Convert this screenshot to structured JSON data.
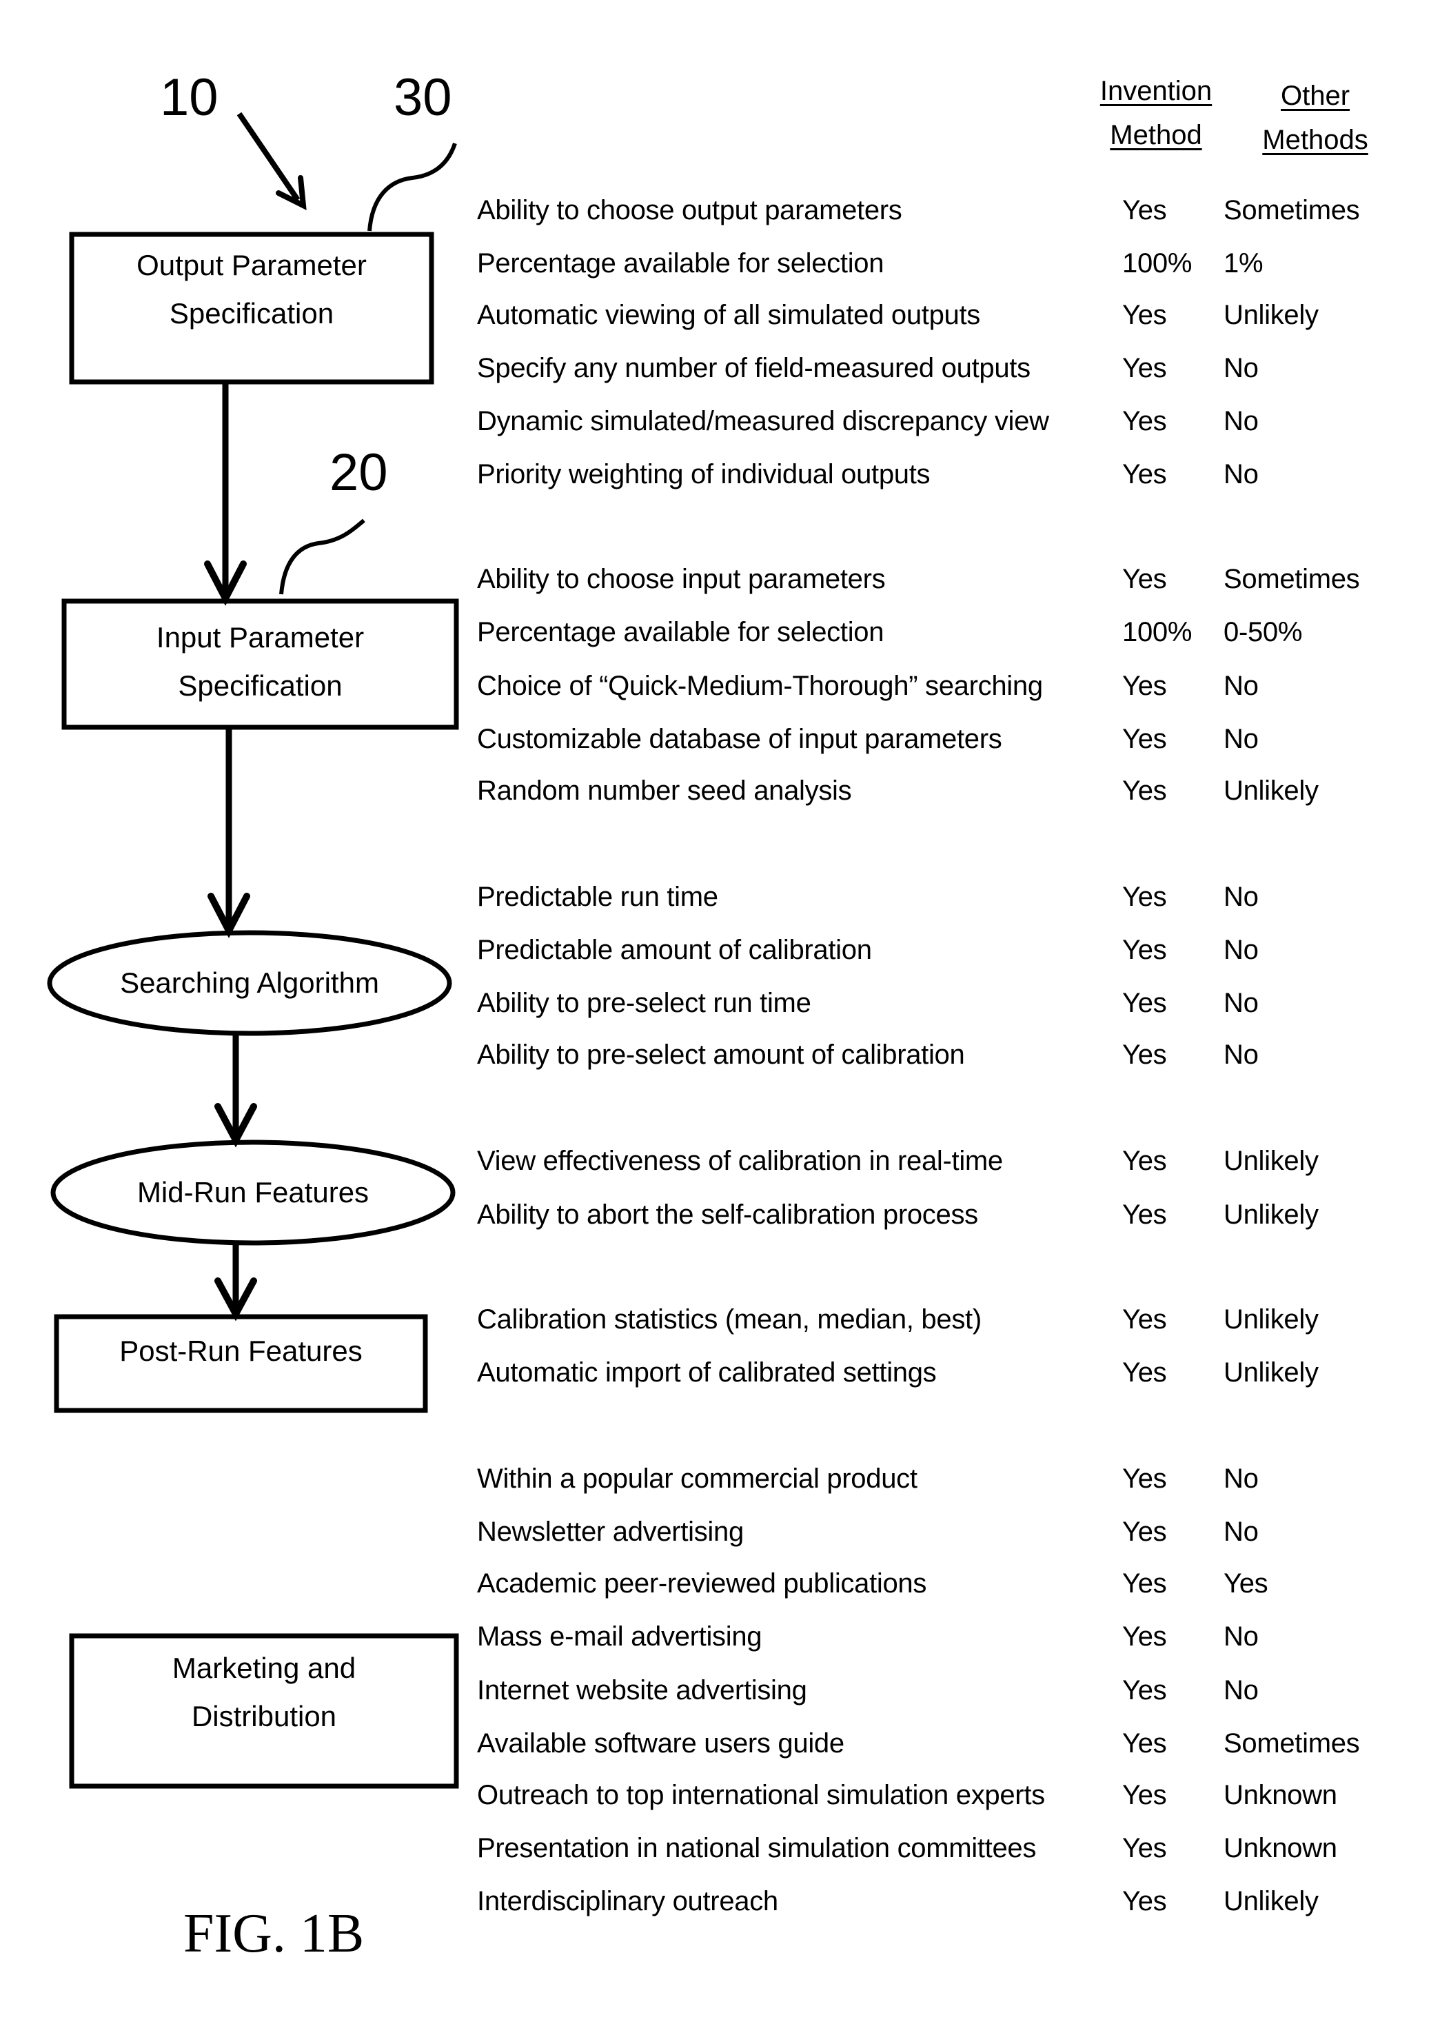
{
  "figure_label": "FIG. 1B",
  "reference_numerals": {
    "overall": "10",
    "input_section": "20",
    "output_section": "30"
  },
  "column_headers": {
    "invention": [
      "Invention",
      "Method"
    ],
    "other": [
      "Other",
      "Methods"
    ]
  },
  "flow_nodes": [
    {
      "id": "output",
      "shape": "rectangle",
      "lines": [
        "Output Parameter",
        "Specification"
      ]
    },
    {
      "id": "input",
      "shape": "rectangle",
      "lines": [
        "Input Parameter",
        "Specification"
      ]
    },
    {
      "id": "search",
      "shape": "ellipse",
      "lines": [
        "Searching Algorithm"
      ]
    },
    {
      "id": "midrun",
      "shape": "ellipse",
      "lines": [
        "Mid-Run Features"
      ]
    },
    {
      "id": "postrun",
      "shape": "rectangle",
      "lines": [
        "Post-Run Features"
      ]
    },
    {
      "id": "marketing",
      "shape": "rectangle",
      "lines": [
        "Marketing and",
        "Distribution"
      ]
    }
  ],
  "feature_groups": [
    {
      "node": "output",
      "rows": [
        {
          "feature": "Ability to choose output parameters",
          "invention": "Yes",
          "other": "Sometimes"
        },
        {
          "feature": "Percentage available for selection",
          "invention": "100%",
          "other": "1%"
        },
        {
          "feature": "Automatic viewing of all simulated outputs",
          "invention": "Yes",
          "other": "Unlikely"
        },
        {
          "feature": "Specify any number of field-measured outputs",
          "invention": "Yes",
          "other": "No"
        },
        {
          "feature": "Dynamic simulated/measured discrepancy view",
          "invention": "Yes",
          "other": "No"
        },
        {
          "feature": "Priority weighting of individual outputs",
          "invention": "Yes",
          "other": "No"
        }
      ]
    },
    {
      "node": "input",
      "rows": [
        {
          "feature": "Ability to choose input parameters",
          "invention": "Yes",
          "other": "Sometimes"
        },
        {
          "feature": "Percentage available for selection",
          "invention": "100%",
          "other": "0-50%"
        },
        {
          "feature": "Choice of “Quick-Medium-Thorough” searching",
          "invention": "Yes",
          "other": "No"
        },
        {
          "feature": "Customizable database of input parameters",
          "invention": "Yes",
          "other": "No"
        },
        {
          "feature": "Random number seed analysis",
          "invention": "Yes",
          "other": "Unlikely"
        }
      ]
    },
    {
      "node": "search",
      "rows": [
        {
          "feature": "Predictable run time",
          "invention": "Yes",
          "other": "No"
        },
        {
          "feature": "Predictable amount of calibration",
          "invention": "Yes",
          "other": "No"
        },
        {
          "feature": "Ability to pre-select run time",
          "invention": "Yes",
          "other": "No"
        },
        {
          "feature": "Ability to pre-select amount of calibration",
          "invention": "Yes",
          "other": "No"
        }
      ]
    },
    {
      "node": "midrun",
      "rows": [
        {
          "feature": "View effectiveness of calibration in real-time",
          "invention": "Yes",
          "other": "Unlikely"
        },
        {
          "feature": "Ability to abort the self-calibration process",
          "invention": "Yes",
          "other": "Unlikely"
        }
      ]
    },
    {
      "node": "postrun",
      "rows": [
        {
          "feature": "Calibration statistics (mean, median, best)",
          "invention": "Yes",
          "other": "Unlikely"
        },
        {
          "feature": "Automatic import of calibrated settings",
          "invention": "Yes",
          "other": "Unlikely"
        }
      ]
    },
    {
      "node": "marketing",
      "rows": [
        {
          "feature": "Within a popular commercial product",
          "invention": "Yes",
          "other": "No"
        },
        {
          "feature": "Newsletter advertising",
          "invention": "Yes",
          "other": "No"
        },
        {
          "feature": "Academic peer-reviewed publications",
          "invention": "Yes",
          "other": "Yes"
        },
        {
          "feature": "Mass e-mail advertising",
          "invention": "Yes",
          "other": "No"
        },
        {
          "feature": "Internet website advertising",
          "invention": "Yes",
          "other": "No"
        },
        {
          "feature": "Available software users guide",
          "invention": "Yes",
          "other": "Sometimes"
        },
        {
          "feature": "Outreach to top international simulation experts",
          "invention": "Yes",
          "other": "Unknown"
        },
        {
          "feature": "Presentation in national simulation committees",
          "invention": "Yes",
          "other": "Unknown"
        },
        {
          "feature": "Interdisciplinary outreach",
          "invention": "Yes",
          "other": "Unlikely"
        }
      ]
    }
  ]
}
